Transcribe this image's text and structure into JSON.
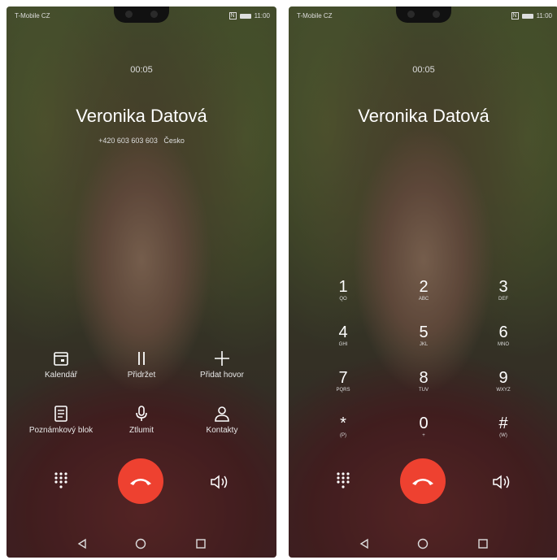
{
  "status_bar": {
    "carrier": "T-Mobile CZ",
    "nfc": "N",
    "time": "11:00"
  },
  "call": {
    "timer": "00:05",
    "caller_name": "Veronika Datová",
    "caller_number": "+420 603 603 603",
    "caller_country": "Česko"
  },
  "actions": [
    {
      "label": "Kalendář",
      "icon": "calendar-icon"
    },
    {
      "label": "Přidržet",
      "icon": "pause-icon"
    },
    {
      "label": "Přidat hovor",
      "icon": "plus-icon"
    },
    {
      "label": "Poznámkový blok",
      "icon": "notepad-icon"
    },
    {
      "label": "Ztlumit",
      "icon": "microphone-icon"
    },
    {
      "label": "Kontakty",
      "icon": "contact-icon"
    }
  ],
  "dialpad": [
    {
      "digit": "1",
      "letters": "QO"
    },
    {
      "digit": "2",
      "letters": "ABC"
    },
    {
      "digit": "3",
      "letters": "DEF"
    },
    {
      "digit": "4",
      "letters": "GHI"
    },
    {
      "digit": "5",
      "letters": "JKL"
    },
    {
      "digit": "6",
      "letters": "MNO"
    },
    {
      "digit": "7",
      "letters": "PQRS"
    },
    {
      "digit": "8",
      "letters": "TUV"
    },
    {
      "digit": "9",
      "letters": "WXYZ"
    },
    {
      "digit": "*",
      "letters": "(P)"
    },
    {
      "digit": "0",
      "letters": "+"
    },
    {
      "digit": "#",
      "letters": "(W)"
    }
  ],
  "colors": {
    "end_call": "#ee4130",
    "overlay_text": "#ffffff"
  }
}
